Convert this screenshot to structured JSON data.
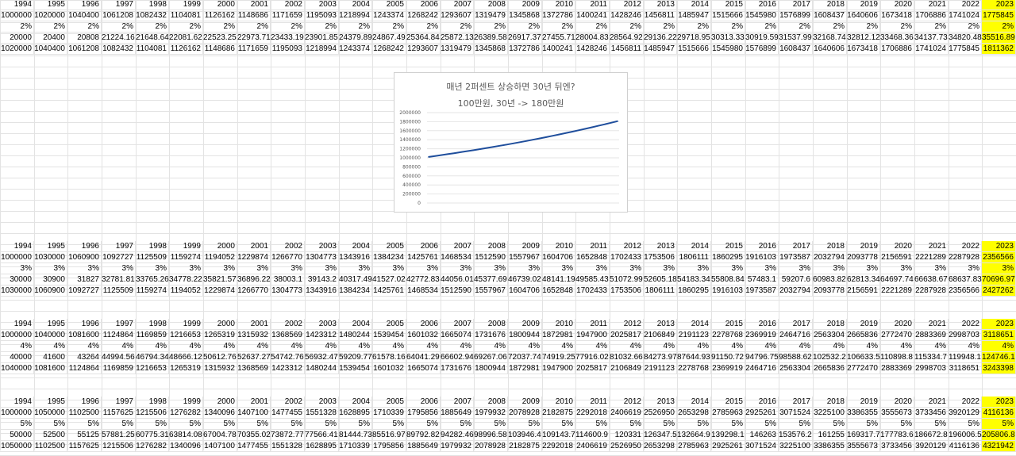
{
  "sheet": {
    "years": [
      "1994",
      "1995",
      "1996",
      "1997",
      "1998",
      "1999",
      "2000",
      "2001",
      "2002",
      "2003",
      "2004",
      "2005",
      "2006",
      "2007",
      "2008",
      "2009",
      "2010",
      "2011",
      "2012",
      "2013",
      "2014",
      "2015",
      "2016",
      "2017",
      "2018",
      "2019",
      "2020",
      "2021",
      "2022",
      "2023"
    ],
    "blocks": [
      {
        "rate": "2%",
        "base": [
          "1000000",
          "1020000",
          "1040400",
          "1061208",
          "1082432",
          "1104081",
          "1126162",
          "1148686",
          "1171659",
          "1195093",
          "1218994",
          "1243374",
          "1268242",
          "1293607",
          "1319479",
          "1345868",
          "1372786",
          "1400241",
          "1428246",
          "1456811",
          "1485947",
          "1515666",
          "1545980",
          "1576899",
          "1608437",
          "1640606",
          "1673418",
          "1706886",
          "1741024",
          "1775845"
        ],
        "increase": [
          "20000",
          "20400",
          "20808",
          "21224.16",
          "21648.64",
          "22081.62",
          "22523.25",
          "22973.71",
          "23433.19",
          "23901.85",
          "24379.89",
          "24867.49",
          "25364.84",
          "25872.13",
          "26389.58",
          "26917.37",
          "27455.71",
          "28004.83",
          "28564.92",
          "29136.22",
          "29718.95",
          "30313.33",
          "30919.59",
          "31537.99",
          "32168.74",
          "32812.12",
          "33468.36",
          "34137.73",
          "34820.48",
          "35516.89"
        ],
        "next": [
          "1020000",
          "1040400",
          "1061208",
          "1082432",
          "1104081",
          "1126162",
          "1148686",
          "1171659",
          "1195093",
          "1218994",
          "1243374",
          "1268242",
          "1293607",
          "1319479",
          "1345868",
          "1372786",
          "1400241",
          "1428246",
          "1456811",
          "1485947",
          "1515666",
          "1545980",
          "1576899",
          "1608437",
          "1640606",
          "1673418",
          "1706886",
          "1741024",
          "1775845",
          "1811362"
        ]
      },
      {
        "rate": "3%",
        "base": [
          "1000000",
          "1030000",
          "1060900",
          "1092727",
          "1125509",
          "1159274",
          "1194052",
          "1229874",
          "1266770",
          "1304773",
          "1343916",
          "1384234",
          "1425761",
          "1468534",
          "1512590",
          "1557967",
          "1604706",
          "1652848",
          "1702433",
          "1753506",
          "1806111",
          "1860295",
          "1916103",
          "1973587",
          "2032794",
          "2093778",
          "2156591",
          "2221289",
          "2287928",
          "2356566"
        ],
        "increase": [
          "30000",
          "30900",
          "31827",
          "32781.81",
          "33765.26",
          "34778.22",
          "35821.57",
          "36896.22",
          "38003.1",
          "39143.2",
          "40317.49",
          "41527.02",
          "42772.83",
          "44056.01",
          "45377.69",
          "46739.02",
          "48141.19",
          "49585.43",
          "51072.99",
          "52605.18",
          "54183.34",
          "55808.84",
          "57483.1",
          "59207.6",
          "60983.82",
          "62813.34",
          "64697.74",
          "66638.67",
          "68637.83",
          "70696.97"
        ],
        "next": [
          "1030000",
          "1060900",
          "1092727",
          "1125509",
          "1159274",
          "1194052",
          "1229874",
          "1266770",
          "1304773",
          "1343916",
          "1384234",
          "1425761",
          "1468534",
          "1512590",
          "1557967",
          "1604706",
          "1652848",
          "1702433",
          "1753506",
          "1806111",
          "1860295",
          "1916103",
          "1973587",
          "2032794",
          "2093778",
          "2156591",
          "2221289",
          "2287928",
          "2356566",
          "2427262"
        ]
      },
      {
        "rate": "4%",
        "base": [
          "1000000",
          "1040000",
          "1081600",
          "1124864",
          "1169859",
          "1216653",
          "1265319",
          "1315932",
          "1368569",
          "1423312",
          "1480244",
          "1539454",
          "1601032",
          "1665074",
          "1731676",
          "1800944",
          "1872981",
          "1947900",
          "2025817",
          "2106849",
          "2191123",
          "2278768",
          "2369919",
          "2464716",
          "2563304",
          "2665836",
          "2772470",
          "2883369",
          "2998703",
          "3118651"
        ],
        "increase": [
          "40000",
          "41600",
          "43264",
          "44994.56",
          "46794.34",
          "48666.12",
          "50612.76",
          "52637.27",
          "54742.76",
          "56932.47",
          "59209.77",
          "61578.16",
          "64041.29",
          "66602.94",
          "69267.06",
          "72037.74",
          "74919.25",
          "77916.02",
          "81032.66",
          "84273.97",
          "87644.93",
          "91150.72",
          "94796.75",
          "98588.62",
          "102532.2",
          "106633.5",
          "110898.8",
          "115334.7",
          "119948.1",
          "124746.1"
        ],
        "next": [
          "1040000",
          "1081600",
          "1124864",
          "1169859",
          "1216653",
          "1265319",
          "1315932",
          "1368569",
          "1423312",
          "1480244",
          "1539454",
          "1601032",
          "1665074",
          "1731676",
          "1800944",
          "1872981",
          "1947900",
          "2025817",
          "2106849",
          "2191123",
          "2278768",
          "2369919",
          "2464716",
          "2563304",
          "2665836",
          "2772470",
          "2883369",
          "2998703",
          "3118651",
          "3243398"
        ]
      },
      {
        "rate": "5%",
        "base": [
          "1000000",
          "1050000",
          "1102500",
          "1157625",
          "1215506",
          "1276282",
          "1340096",
          "1407100",
          "1477455",
          "1551328",
          "1628895",
          "1710339",
          "1795856",
          "1885649",
          "1979932",
          "2078928",
          "2182875",
          "2292018",
          "2406619",
          "2526950",
          "2653298",
          "2785963",
          "2925261",
          "3071524",
          "3225100",
          "3386355",
          "3555673",
          "3733456",
          "3920129",
          "4116136"
        ],
        "increase": [
          "50000",
          "52500",
          "55125",
          "57881.25",
          "60775.31",
          "63814.08",
          "67004.78",
          "70355.02",
          "73872.77",
          "77566.41",
          "81444.73",
          "85516.97",
          "89792.82",
          "94282.46",
          "98996.58",
          "103946.4",
          "109143.7",
          "114600.9",
          "120331",
          "126347.5",
          "132664.9",
          "139298.1",
          "146263",
          "153576.2",
          "161255",
          "169317.7",
          "177783.6",
          "186672.8",
          "196006.5",
          "205806.8"
        ],
        "next": [
          "1050000",
          "1102500",
          "1157625",
          "1215506",
          "1276282",
          "1340096",
          "1407100",
          "1477455",
          "1551328",
          "1628895",
          "1710339",
          "1795856",
          "1885649",
          "1979932",
          "2078928",
          "2182875",
          "2292018",
          "2406619",
          "2526950",
          "2653298",
          "2785963",
          "2925261",
          "3071524",
          "3225100",
          "3386355",
          "3555673",
          "3733456",
          "3920129",
          "4116136",
          "4321942"
        ]
      }
    ],
    "highlight_color": "#ffff00"
  },
  "chart_data": {
    "type": "line",
    "title": "매년 2퍼센트 상승하면 30년 뒤엔?",
    "subtitle": "100만원, 30년 -> 180만원",
    "y_ticks": [
      "0",
      "200000",
      "400000",
      "600000",
      "800000",
      "1000000",
      "1200000",
      "1400000",
      "1600000",
      "1800000",
      "2000000"
    ],
    "ylim": [
      0,
      2000000
    ],
    "x": [
      "1994",
      "1995",
      "1996",
      "1997",
      "1998",
      "1999",
      "2000",
      "2001",
      "2002",
      "2003",
      "2004",
      "2005",
      "2006",
      "2007",
      "2008",
      "2009",
      "2010",
      "2011",
      "2012",
      "2013",
      "2014",
      "2015",
      "2016",
      "2017",
      "2018",
      "2019",
      "2020",
      "2021",
      "2022",
      "2023"
    ],
    "values": [
      1020000,
      1040400,
      1061208,
      1082432,
      1104081,
      1126162,
      1148686,
      1171659,
      1195093,
      1218994,
      1243374,
      1268242,
      1293607,
      1319479,
      1345868,
      1372786,
      1400241,
      1428246,
      1456811,
      1485947,
      1515666,
      1545980,
      1576899,
      1608437,
      1640606,
      1673418,
      1706886,
      1741024,
      1775845,
      1811362
    ],
    "line_color": "#1f4e9c",
    "grid": true,
    "legend": "none"
  }
}
